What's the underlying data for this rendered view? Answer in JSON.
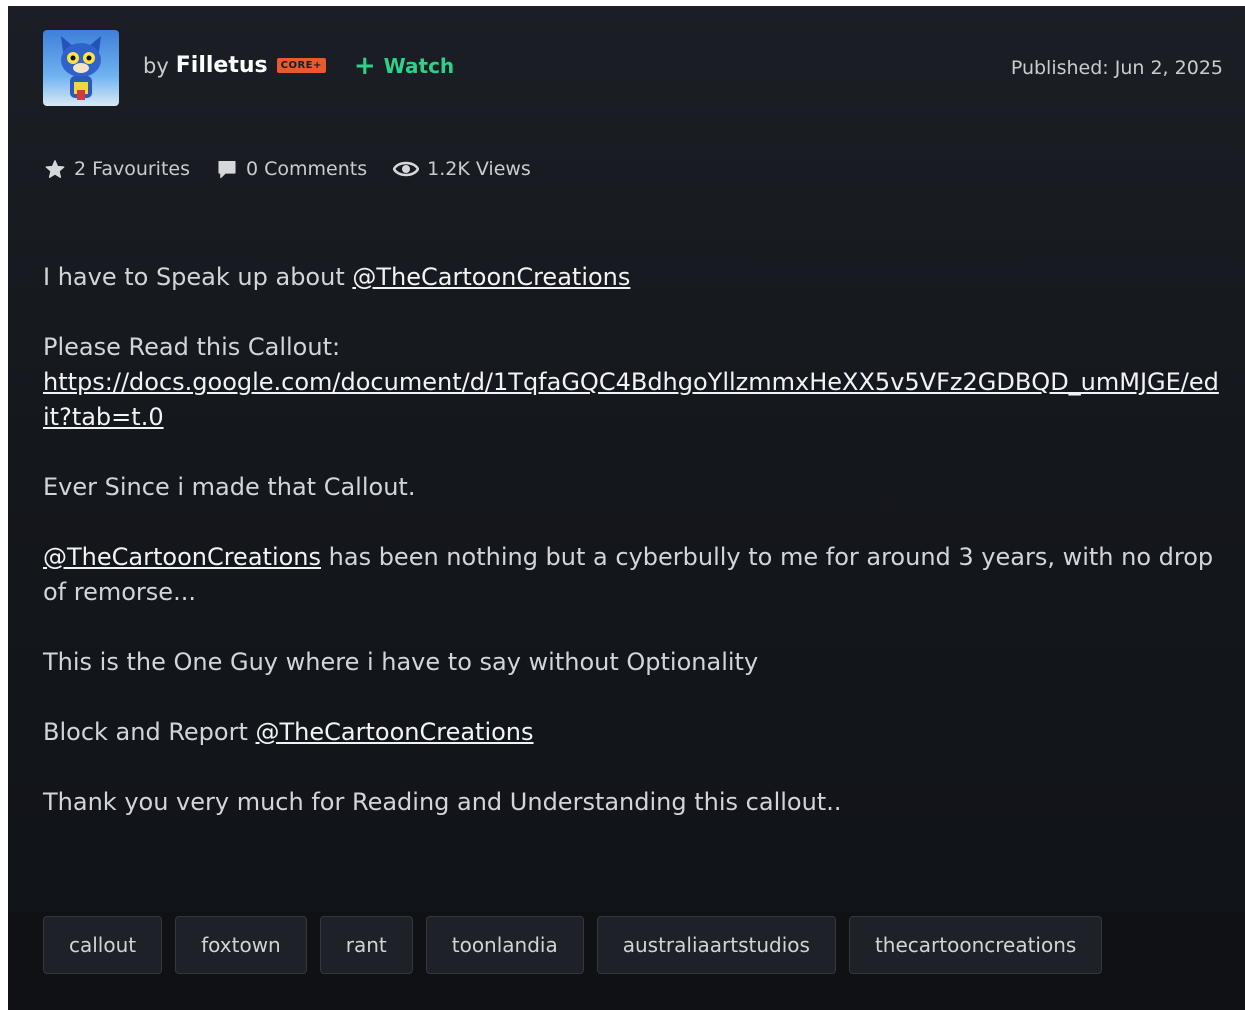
{
  "header": {
    "by_prefix": "by",
    "username": "Filletus",
    "badge": "CORE+",
    "watch_label": "Watch",
    "published": "Published: Jun 2, 2025"
  },
  "stats": {
    "favourites": "2 Favourites",
    "comments": "0 Comments",
    "views": "1.2K Views"
  },
  "content": {
    "p1_text": "I have to Speak up about ",
    "p1_mention": "@TheCartoonCreations",
    "p2_text": "Please Read this Callout:",
    "p2_link": "https://docs.google.com/document/d/1TqfaGQC4BdhgoYllzmmxHeXX5v5VFz2GDBQD_umMJGE/edit?tab=t.0",
    "p3_text": "Ever Since i made that Callout.",
    "p4_mention": "@TheCartoonCreations",
    "p4_text": " has been nothing but a cyberbully to me for around 3 years, with no drop of remorse...",
    "p5_text": "This is the One Guy where i have to say without Optionality",
    "p6_text": "Block and Report ",
    "p6_mention": "@TheCartoonCreations",
    "p7_text": "Thank you very much for Reading and Understanding this callout.."
  },
  "tags": [
    "callout",
    "foxtown",
    "rant",
    "toonlandia",
    "australiaartstudios",
    "thecartooncreations"
  ],
  "colors": {
    "watch": "#2ed08a",
    "badge": "#e8592b",
    "background": "#14171c"
  }
}
